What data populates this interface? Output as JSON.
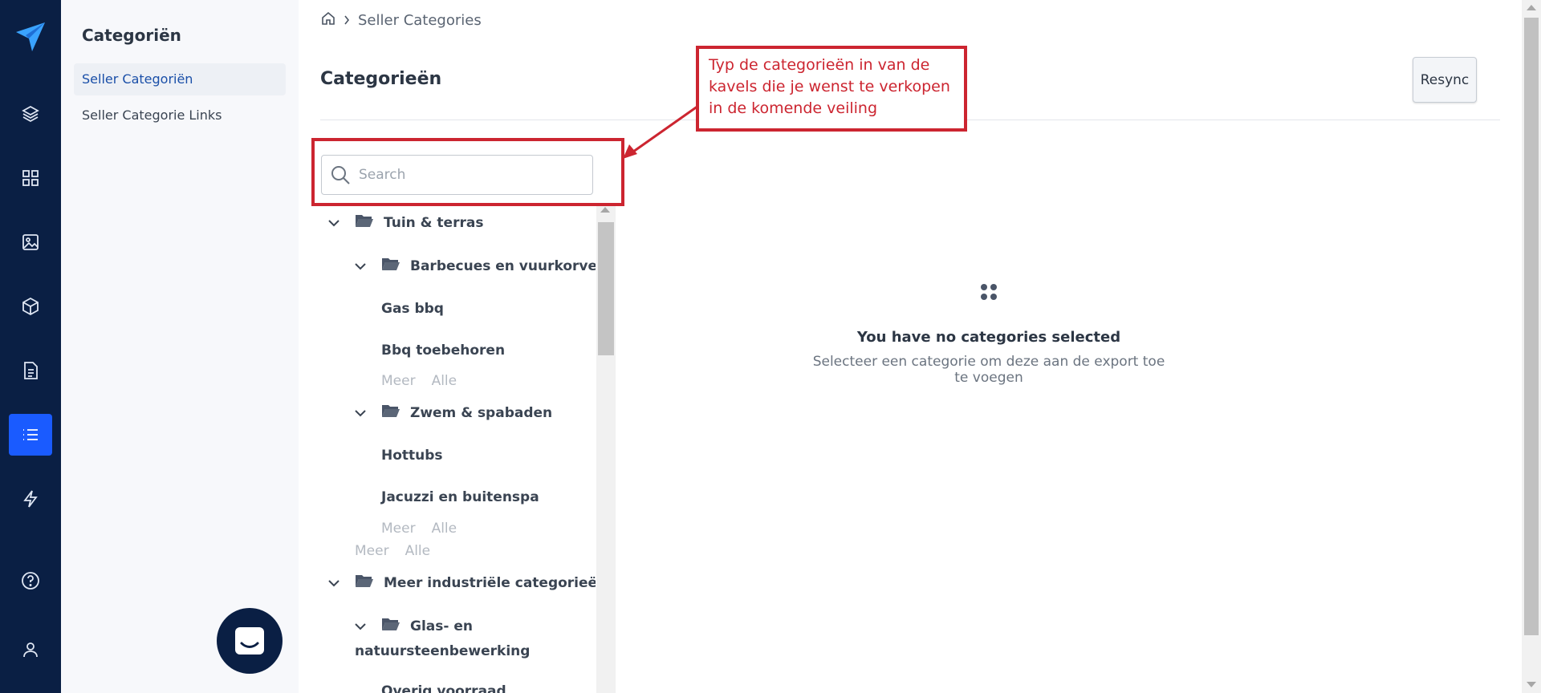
{
  "colors": {
    "rail_bg": "#0a1f44",
    "active_nav": "#1a5bff",
    "annotation_red": "#cc2530",
    "link_blue": "#1a4fa8"
  },
  "rail": {
    "icons": [
      "paper-plane-logo-icon",
      "layers-icon",
      "grid-icon",
      "image-icon",
      "box-icon",
      "document-icon",
      "list-icon",
      "lightning-icon",
      "help-icon",
      "user-icon"
    ],
    "active": "list-icon"
  },
  "subnav": {
    "title": "Categoriën",
    "items": [
      {
        "label": "Seller Categoriën",
        "active": true
      },
      {
        "label": "Seller Categorie Links",
        "active": false
      }
    ]
  },
  "breadcrumb": {
    "current": "Seller Categories"
  },
  "page": {
    "title": "Categorieën",
    "resync_label": "Resync"
  },
  "search": {
    "placeholder": "Search",
    "value": ""
  },
  "tree": {
    "groups": [
      {
        "label": "Tuin & terras",
        "children": [
          {
            "label": "Barbecues en vuurkorven",
            "leaves": [
              "Gas bbq",
              "Bbq toebehoren"
            ],
            "more": "Meer",
            "all": "Alle"
          },
          {
            "label": "Zwem & spabaden",
            "leaves": [
              "Hottubs",
              "Jacuzzi en buitenspa"
            ],
            "more": "Meer",
            "all": "Alle"
          }
        ],
        "more": "Meer",
        "all": "Alle"
      },
      {
        "label": "Meer industriële categorieën",
        "children": [
          {
            "label_line1": "Glas- en",
            "label_line2": "natuursteenbewerking",
            "leaves": [
              "Overig voorraad"
            ]
          }
        ]
      }
    ]
  },
  "empty_state": {
    "headline": "You have no categories selected",
    "subtext": "Selecteer een categorie om deze aan de export toe te voegen"
  },
  "annotation": {
    "lines": [
      "Typ de categorieën in van de",
      "kavels die je wenst te verkopen",
      "in de komende veiling"
    ]
  }
}
